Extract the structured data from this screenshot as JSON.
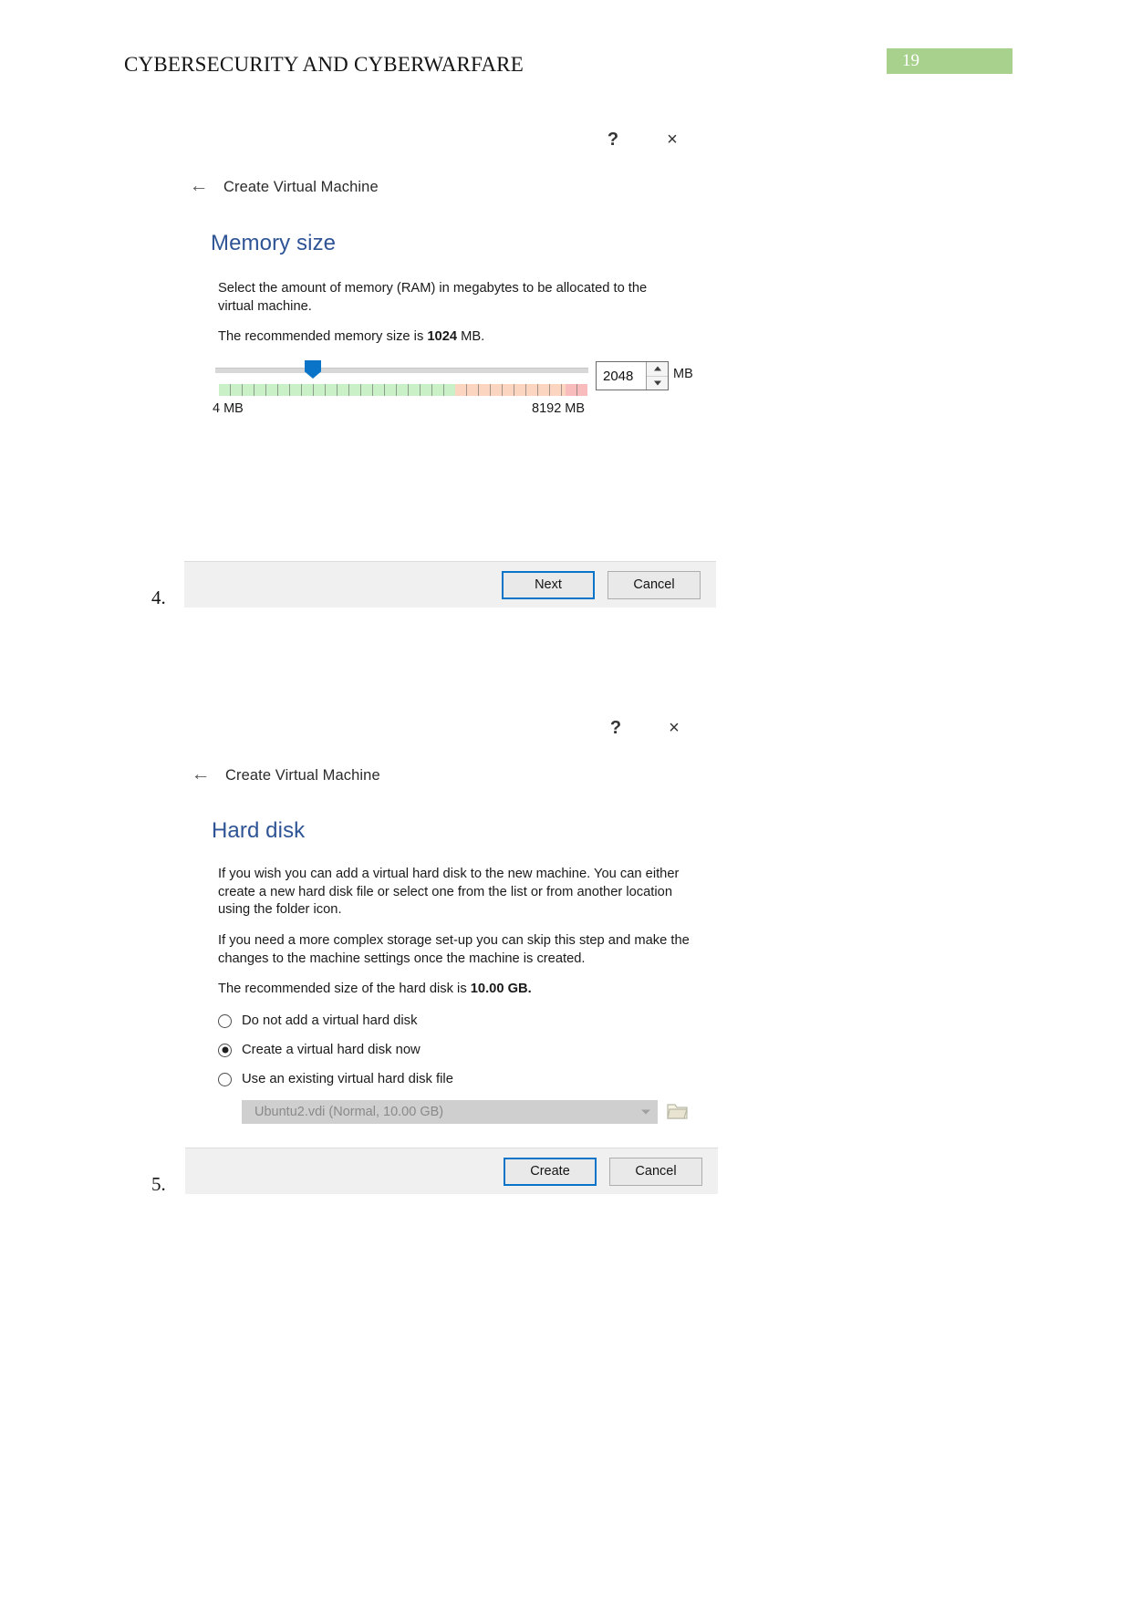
{
  "document": {
    "header_title": "CYBERSECURITY AND CYBERWARFARE",
    "page_number": "19",
    "accent_green": "#a9d18e",
    "heading_blue": "#2f5496"
  },
  "list_markers": {
    "item4": "4.",
    "item5": "5."
  },
  "dialog_memory": {
    "help_icon": "?",
    "close_icon": "×",
    "back_icon": "←",
    "nav_title": "Create Virtual Machine",
    "heading": "Memory size",
    "paragraph1": "Select the amount of memory (RAM) in megabytes to be allocated to the virtual machine.",
    "paragraph2_prefix": "The recommended memory size is ",
    "paragraph2_value": "1024",
    "paragraph2_suffix": " MB.",
    "slider": {
      "value": "2048",
      "unit": "MB",
      "min_label": "4 MB",
      "max_label": "8192 MB",
      "thumb_percent": 26,
      "green_percent": 64,
      "orange_percent": 30,
      "red_percent": 6
    },
    "buttons": {
      "primary": "Next",
      "secondary": "Cancel"
    }
  },
  "dialog_harddisk": {
    "help_icon": "?",
    "close_icon": "×",
    "back_icon": "←",
    "nav_title": "Create Virtual Machine",
    "heading": "Hard disk",
    "paragraph1": "If you wish you can add a virtual hard disk to the new machine. You can either create a new hard disk file or select one from the list or from another location using the folder icon.",
    "paragraph2": "If you need a more complex storage set-up you can skip this step and make the changes to the machine settings once the machine is created.",
    "paragraph3_prefix": "The recommended size of the hard disk is ",
    "paragraph3_value": "10.00 GB.",
    "options": [
      {
        "label": "Do not add a virtual hard disk",
        "selected": false
      },
      {
        "label": "Create a virtual hard disk now",
        "selected": true
      },
      {
        "label": "Use an existing virtual hard disk file",
        "selected": false
      }
    ],
    "existing_disk": {
      "value": "Ubuntu2.vdi (Normal, 10.00 GB)",
      "disabled": true
    },
    "buttons": {
      "primary": "Create",
      "secondary": "Cancel"
    }
  }
}
